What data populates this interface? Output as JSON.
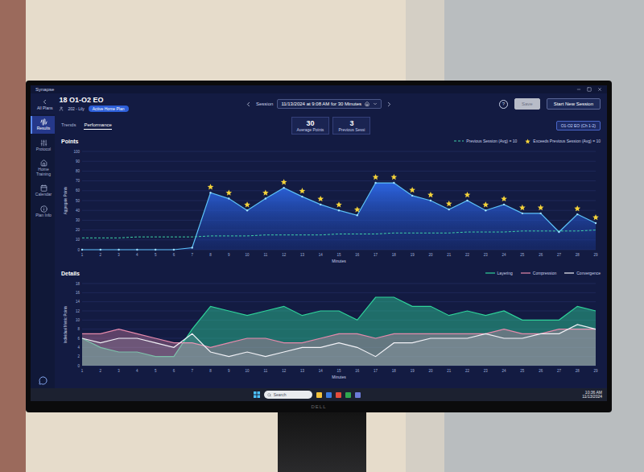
{
  "window": {
    "title": "Synapse"
  },
  "header": {
    "back": "All Plans",
    "plan_title": "18 O1-O2 EO",
    "user": "202 - Lily",
    "badge": "Active Home Plan",
    "session_label": "Session",
    "session_value": "11/13/2024 at 9:08 AM for 30 Minutes",
    "help": "?",
    "save": {
      "label": "Save",
      "disabled": true
    },
    "start": "Start New Session"
  },
  "sidebar": {
    "items": [
      {
        "label": "Results",
        "selected": true
      },
      {
        "label": "Protocol",
        "selected": false
      },
      {
        "label": "Home Training",
        "selected": false
      },
      {
        "label": "Calendar",
        "selected": false
      },
      {
        "label": "Plan Info",
        "selected": false
      }
    ]
  },
  "tabs": [
    {
      "label": "Trends",
      "selected": false
    },
    {
      "label": "Performance",
      "selected": true
    }
  ],
  "stats": [
    {
      "value": "30",
      "label": "Average Points"
    },
    {
      "value": "3",
      "label": "Previous Sessi"
    }
  ],
  "channel_badge": "O1-O2 EO (Ch 1-2)",
  "points_chart": {
    "title": "Points",
    "y_label": "Aggregate Points",
    "x_label": "Minutes",
    "y_ticks": [
      "0",
      "10",
      "20",
      "30",
      "40",
      "50",
      "60",
      "70",
      "80",
      "90",
      "100"
    ],
    "x_ticks": [
      "1",
      "2",
      "3",
      "4",
      "5",
      "6",
      "7",
      "8",
      "9",
      "10",
      "11",
      "12",
      "13",
      "14",
      "15",
      "16",
      "17",
      "18",
      "19",
      "20",
      "21",
      "22",
      "23",
      "24",
      "25",
      "26",
      "27",
      "28",
      "29"
    ],
    "legend": [
      {
        "label": "Previous Session (Avg) = 10",
        "kind": "dashed",
        "color": "#3fd0a8"
      },
      {
        "label": "Exceeds Previous Session (Avg) = 10",
        "kind": "star",
        "color": "#f5d33a"
      }
    ],
    "points": [
      0,
      0,
      0,
      0,
      0,
      0,
      2,
      58,
      52,
      40,
      52,
      63,
      54,
      46,
      40,
      35,
      68,
      68,
      55,
      50,
      41,
      50,
      40,
      46,
      37,
      37,
      18,
      36,
      27
    ],
    "previous": [
      12,
      12,
      12,
      13,
      13,
      13,
      13,
      14,
      14,
      14,
      15,
      15,
      15,
      15,
      16,
      16,
      16,
      17,
      17,
      17,
      17,
      18,
      18,
      18,
      19,
      19,
      19,
      19,
      20
    ]
  },
  "details_chart": {
    "title": "Details",
    "y_label": "Individual Metric Points",
    "x_label": "Minutes",
    "y_ticks": [
      "0",
      "2",
      "4",
      "6",
      "8",
      "10",
      "12",
      "14",
      "16",
      "18"
    ],
    "x_ticks": [
      "1",
      "2",
      "3",
      "4",
      "5",
      "6",
      "7",
      "8",
      "9",
      "10",
      "11",
      "12",
      "13",
      "14",
      "15",
      "16",
      "17",
      "18",
      "19",
      "20",
      "21",
      "22",
      "23",
      "24",
      "25",
      "26",
      "27",
      "28",
      "29"
    ],
    "series": [
      {
        "name": "Layering",
        "color": "#2fd39a",
        "values": [
          6,
          4,
          3,
          3,
          2,
          2,
          8,
          13,
          12,
          11,
          12,
          13,
          11,
          12,
          12,
          10,
          15,
          15,
          13,
          13,
          11,
          12,
          11,
          12,
          10,
          10,
          10,
          13,
          12
        ]
      },
      {
        "name": "Compression",
        "color": "#e68aac",
        "values": [
          7,
          7,
          8,
          7,
          6,
          5,
          5,
          4,
          5,
          6,
          6,
          5,
          5,
          6,
          7,
          7,
          6,
          7,
          7,
          7,
          7,
          7,
          7,
          8,
          7,
          7,
          8,
          8,
          8
        ]
      },
      {
        "name": "Convergence",
        "color": "#f2f2f7",
        "values": [
          6,
          5,
          6,
          6,
          5,
          4,
          7,
          3,
          2,
          3,
          2,
          3,
          4,
          4,
          5,
          4,
          2,
          5,
          5,
          6,
          6,
          6,
          7,
          6,
          6,
          7,
          7,
          9,
          8
        ]
      }
    ]
  },
  "taskbar": {
    "search": "Search",
    "time": "10:36 AM",
    "date": "11/13/2024"
  },
  "monitor": {
    "brand": "DELL"
  }
}
